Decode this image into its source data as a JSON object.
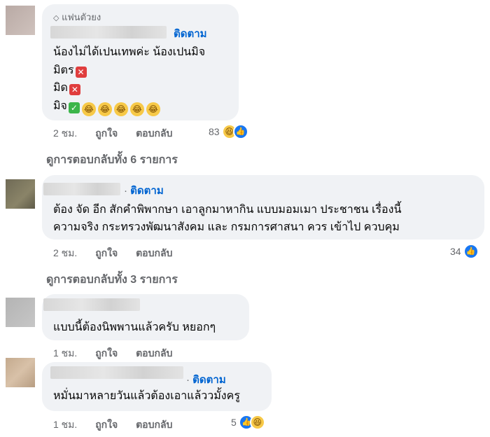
{
  "comment1": {
    "badge": "แฟนตัวยง",
    "follow": "ติดตาม",
    "line1": "น้องไม่ได้เปนเทพค่ะ น้องเปนมิจ",
    "line2": "มิตร",
    "line3": "มิด",
    "line4": "มิจ",
    "time": "2 ชม.",
    "like": "ถูกใจ",
    "reply": "ตอบกลับ",
    "reaction_count": "83"
  },
  "comment1_replies": "ดูการตอบกลับทั้ง 6 รายการ",
  "comment2": {
    "follow": "ติดตาม",
    "line1": "ต้อง จัด อีก สักคำพิพากษา เอาลูกมาหากิน แบบมอมเมา ประชาชน เรื่องนี้",
    "line2": "ความจริง กระทรวงพัฒนาสังคม และ กรมการศาสนา ควร เข้าไป ควบคุม",
    "time": "2 ชม.",
    "like": "ถูกใจ",
    "reply": "ตอบกลับ",
    "reaction_count": "34"
  },
  "comment2_replies": "ดูการตอบกลับทั้ง 3 รายการ",
  "comment3": {
    "line1": "แบบนี้ต้องนิพพานแล้วครับ หยอกๆ",
    "time": "1 ชม.",
    "like": "ถูกใจ",
    "reply": "ตอบกลับ"
  },
  "comment4": {
    "follow": "ติดตาม",
    "line1": "หมั่นมาหลายวันแล้วต้องเอาแล้ววมั้งครู",
    "time": "1 ชม.",
    "like": "ถูกใจ",
    "reply": "ตอบกลับ",
    "reaction_count": "5"
  },
  "icons": {
    "badge": "diamond-icon",
    "wrong": "cross-mark-icon",
    "right": "check-mark-icon",
    "laugh": "rofl-emoji-icon",
    "like": "like-reaction-icon",
    "haha": "haha-reaction-icon"
  },
  "colors": {
    "bubble": "#f0f2f5",
    "link_blue": "#0064d1",
    "meta_gray": "#65676b",
    "like_blue": "#1877f2"
  }
}
